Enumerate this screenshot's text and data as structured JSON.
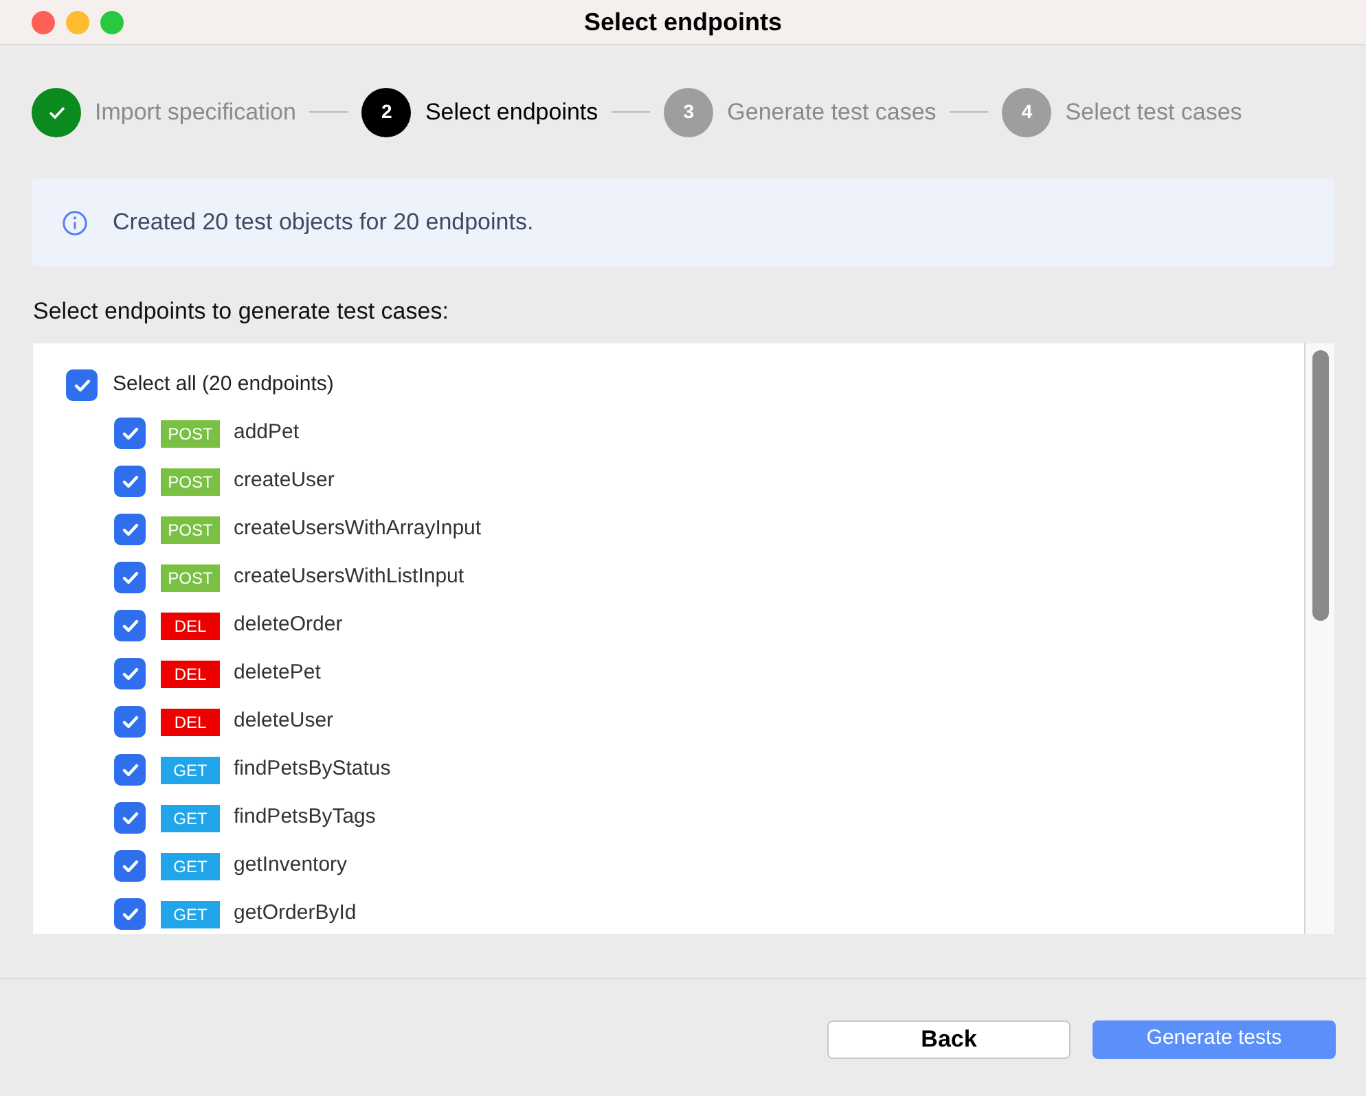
{
  "window": {
    "title": "Select endpoints"
  },
  "steps": [
    {
      "label": "Import specification",
      "completed": true,
      "selected": false
    },
    {
      "number": "2",
      "label": "Select endpoints",
      "completed": false,
      "selected": true
    },
    {
      "number": "3",
      "label": "Generate test cases",
      "completed": false,
      "selected": false
    },
    {
      "number": "4",
      "label": "Select test cases",
      "completed": false,
      "selected": false
    }
  ],
  "info": {
    "message": "Created 20 test objects for 20 endpoints."
  },
  "list_label": "Select endpoints to generate test cases:",
  "select_all": {
    "label": "Select all (20 endpoints)",
    "checked": true
  },
  "endpoints": [
    {
      "method": "POST",
      "kind": "post",
      "name": "addPet",
      "checked": true
    },
    {
      "method": "POST",
      "kind": "post",
      "name": "createUser",
      "checked": true
    },
    {
      "method": "POST",
      "kind": "post",
      "name": "createUsersWithArrayInput",
      "checked": true
    },
    {
      "method": "POST",
      "kind": "post",
      "name": "createUsersWithListInput",
      "checked": true
    },
    {
      "method": "DEL",
      "kind": "delete",
      "name": "deleteOrder",
      "checked": true
    },
    {
      "method": "DEL",
      "kind": "delete",
      "name": "deletePet",
      "checked": true
    },
    {
      "method": "DEL",
      "kind": "delete",
      "name": "deleteUser",
      "checked": true
    },
    {
      "method": "GET",
      "kind": "get",
      "name": "findPetsByStatus",
      "checked": true
    },
    {
      "method": "GET",
      "kind": "get",
      "name": "findPetsByTags",
      "checked": true
    },
    {
      "method": "GET",
      "kind": "get",
      "name": "getInventory",
      "checked": true
    },
    {
      "method": "GET",
      "kind": "get",
      "name": "getOrderById",
      "checked": true
    }
  ],
  "buttons": {
    "back": "Back",
    "generate": "Generate tests"
  }
}
